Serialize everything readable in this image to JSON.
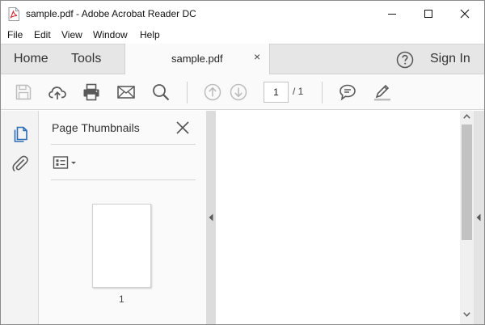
{
  "window": {
    "title": "sample.pdf - Adobe Acrobat Reader DC",
    "app_icon": "pdf-file-icon",
    "controls": [
      "minimize-icon",
      "maximize-icon",
      "close-icon"
    ]
  },
  "menu": {
    "items": [
      "File",
      "Edit",
      "View",
      "Window",
      "Help"
    ]
  },
  "tabs": {
    "home_label": "Home",
    "tools_label": "Tools",
    "document_tab_label": "sample.pdf",
    "document_tab_close": "×",
    "sign_in_label": "Sign In",
    "help_icon": "help-circle-icon"
  },
  "toolbar": {
    "icons": [
      "save-icon",
      "cloud-upload-icon",
      "print-icon",
      "email-icon",
      "search-icon",
      "previous-page-icon",
      "next-page-icon",
      "comment-icon",
      "highlight-pen-icon"
    ],
    "current_page": "1",
    "total_pages": "/ 1"
  },
  "left_rail": {
    "icons": [
      "page-thumbnails-icon",
      "attachments-icon"
    ],
    "accent_color": "#2d6db5"
  },
  "thumbnails_panel": {
    "title": "Page Thumbnails",
    "options_icon": "thumbnail-options-icon",
    "thumbnails": [
      {
        "label": "1"
      }
    ]
  },
  "colors": {
    "tabbar_bg": "#e6e6e6",
    "toolbar_bg": "#fafafa",
    "icon_gray": "#5a5a5a",
    "disabled_icon": "#bdbdbd",
    "accent_blue": "#2d6db5"
  }
}
